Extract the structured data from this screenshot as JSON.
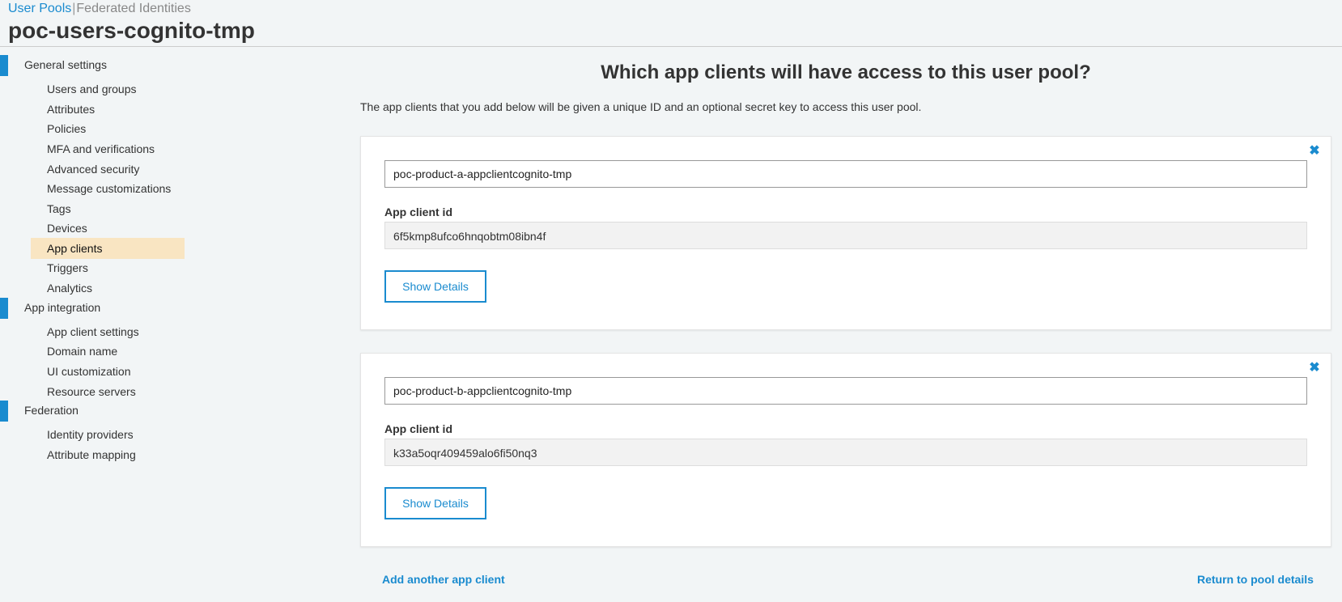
{
  "header": {
    "tabs": [
      "User Pools",
      "Federated Identities"
    ],
    "separator": "|",
    "pool_name": "poc-users-cognito-tmp"
  },
  "sidebar": {
    "sections": [
      {
        "label": "General settings",
        "items": [
          "Users and groups",
          "Attributes",
          "Policies",
          "MFA and verifications",
          "Advanced security",
          "Message customizations",
          "Tags",
          "Devices",
          "App clients",
          "Triggers",
          "Analytics"
        ]
      },
      {
        "label": "App integration",
        "items": [
          "App client settings",
          "Domain name",
          "UI customization",
          "Resource servers"
        ]
      },
      {
        "label": "Federation",
        "items": [
          "Identity providers",
          "Attribute mapping"
        ]
      }
    ],
    "selected_item": "App clients"
  },
  "main": {
    "heading": "Which app clients will have access to this user pool?",
    "intro": "The app clients that you add below will be given a unique ID and an optional secret key to access this user pool.",
    "clients": [
      {
        "name": "poc-product-a-appclientcognito-tmp",
        "id_label": "App client id",
        "id_value": "6f5kmp8ufco6hnqobtm08ibn4f",
        "details_button": "Show Details"
      },
      {
        "name": "poc-product-b-appclientcognito-tmp",
        "id_label": "App client id",
        "id_value": "k33a5oqr409459alo6fi50nq3",
        "details_button": "Show Details"
      }
    ],
    "close_icon": "close-icon",
    "add_link": "Add another app client",
    "return_link": "Return to pool details"
  },
  "colors": {
    "accent": "#1a8bcf",
    "selected_bg": "#f9e5c2",
    "page_bg": "#f2f5f6"
  }
}
